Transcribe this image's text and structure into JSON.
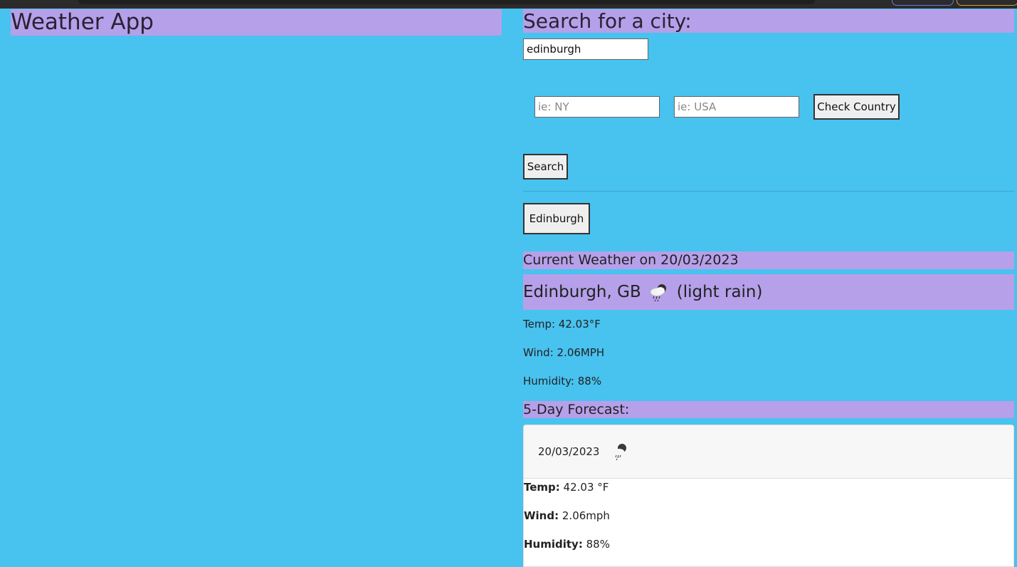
{
  "app": {
    "title": "Weather App"
  },
  "search": {
    "heading": "Search for a city:",
    "city_value": "edinburgh",
    "state_placeholder": "ie: NY",
    "country_placeholder": "ie: USA",
    "check_country_label": "Check Country",
    "search_label": "Search"
  },
  "history": {
    "items": [
      {
        "label": "Edinburgh"
      }
    ]
  },
  "current": {
    "heading": "Current Weather on 20/03/2023",
    "city": "Edinburgh, GB",
    "icon": "light-rain-icon",
    "description": "(light rain)",
    "temp": "Temp: 42.03°F",
    "wind": "Wind: 2.06MPH",
    "humidity": "Humidity: 88%"
  },
  "forecast": {
    "heading": "5-Day Forecast:",
    "days": [
      {
        "date": "20/03/2023",
        "icon": "light-rain-icon",
        "temp_label": "Temp:",
        "temp_value": " 42.03 °F",
        "wind_label": "Wind:",
        "wind_value": " 2.06mph",
        "humidity_label": "Humidity:",
        "humidity_value": " 88%"
      }
    ]
  },
  "colors": {
    "background": "#48c2ef",
    "heading_bg": "#b6a0ea"
  }
}
